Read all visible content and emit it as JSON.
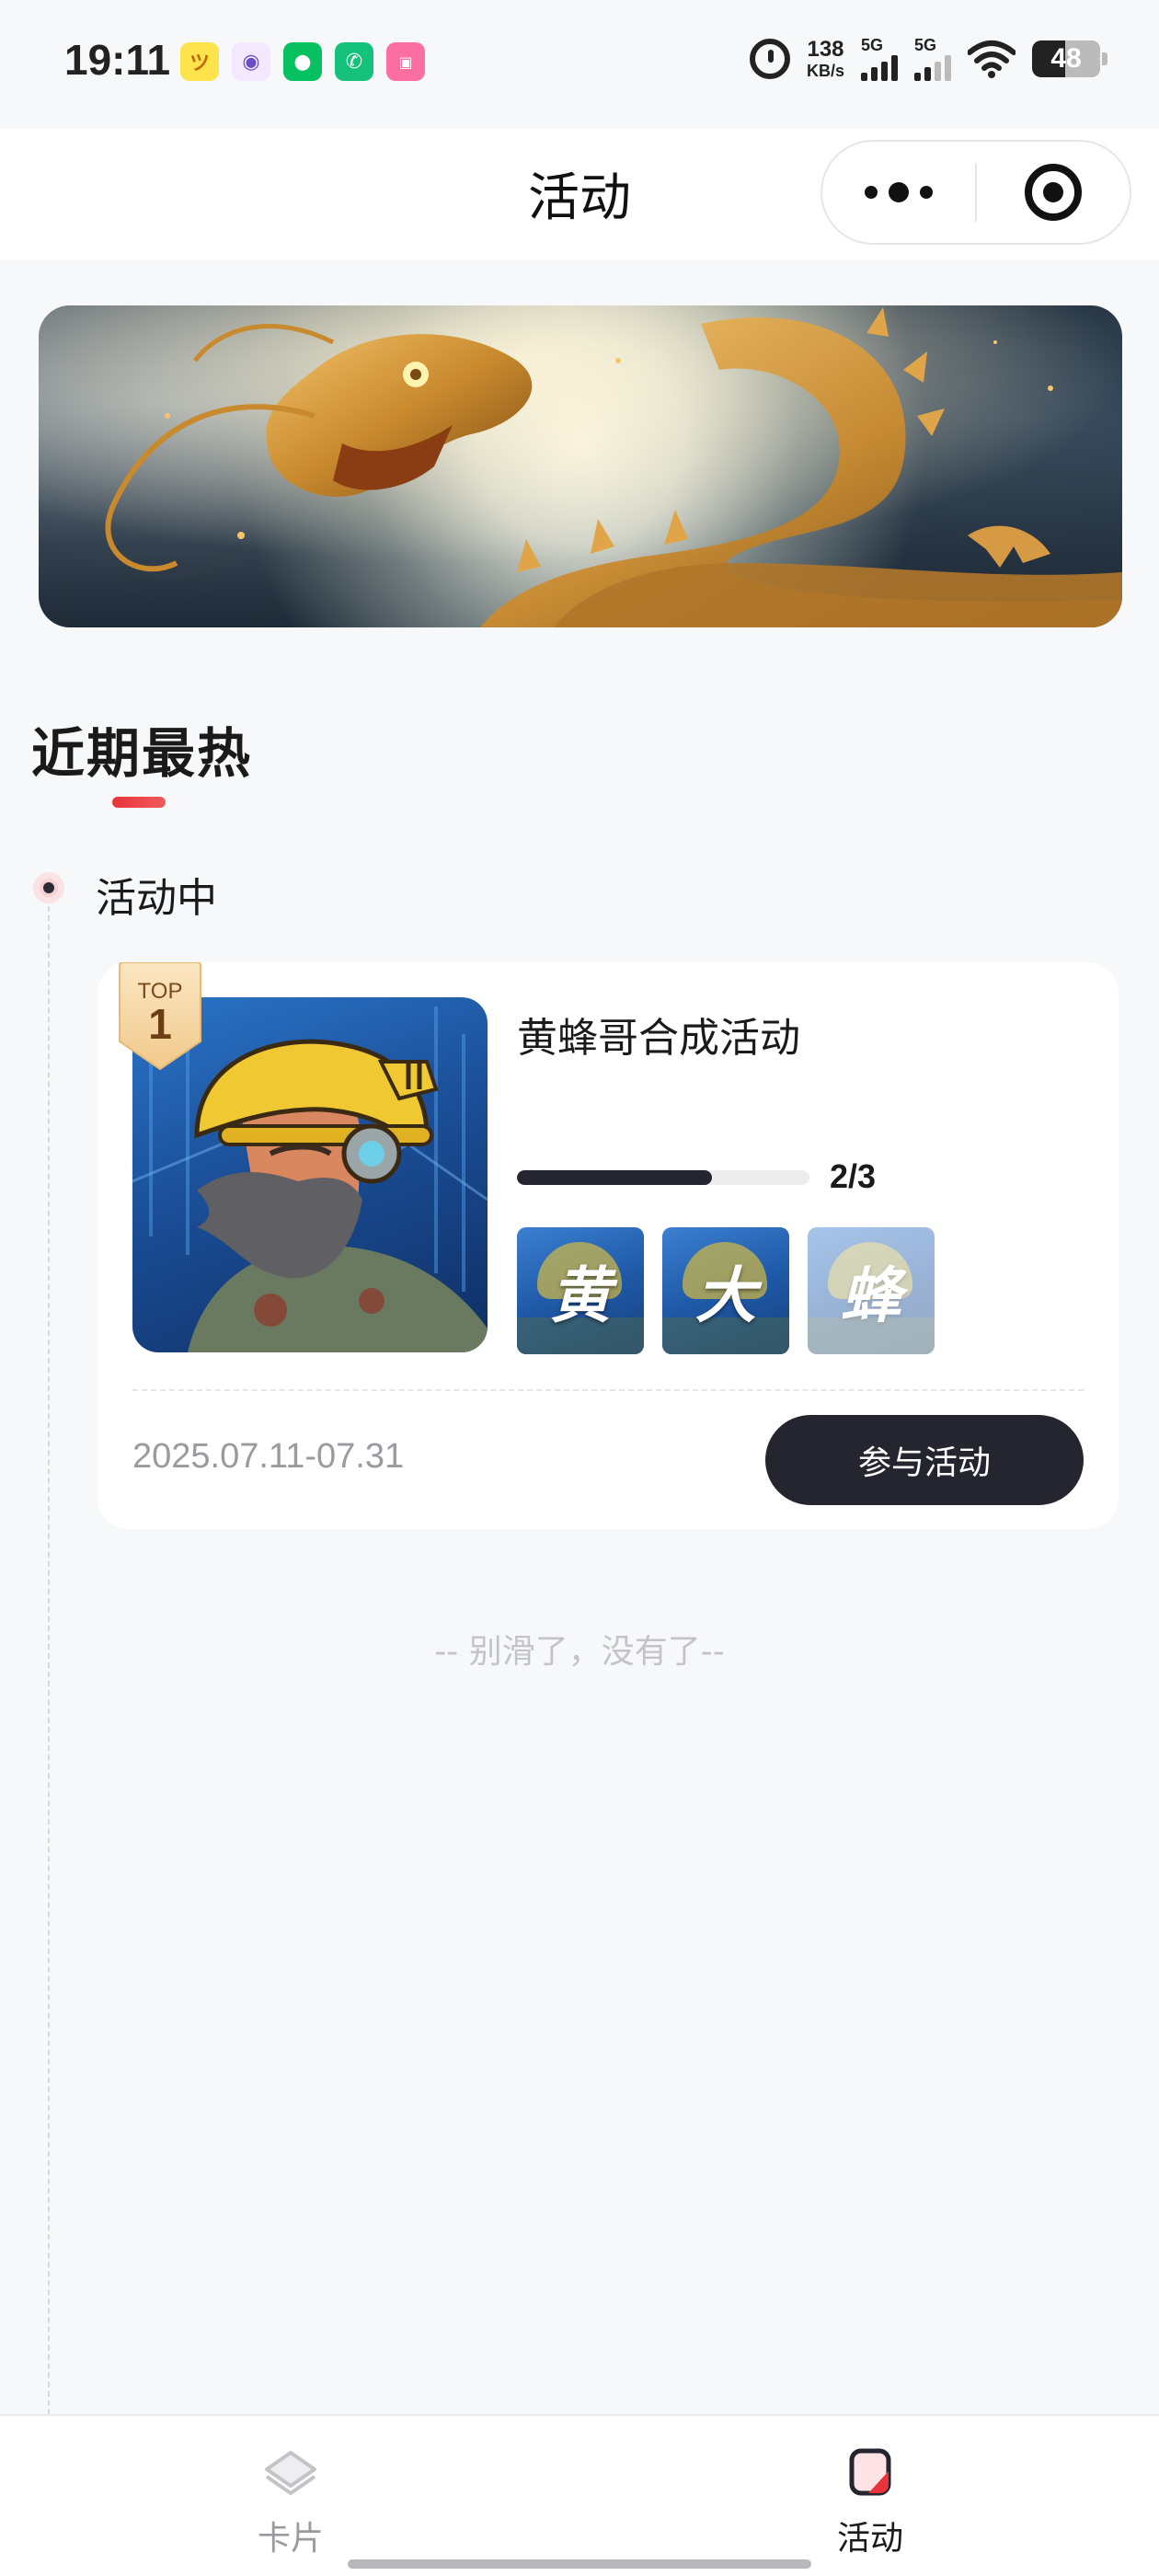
{
  "status_bar": {
    "time": "19:11",
    "net_speed_value": "138",
    "net_speed_unit": "KB/s",
    "sim1_label": "5G",
    "sim2_label": "5G",
    "battery": "48",
    "app_icons": [
      "kid-app-icon",
      "astronaut-app-icon",
      "wechat-icon",
      "phone-app-icon",
      "bilibili-icon"
    ]
  },
  "nav": {
    "title": "活动"
  },
  "section": {
    "title": "近期最热"
  },
  "timeline": {
    "status_label": "活动中"
  },
  "activity": {
    "rank_label": "TOP",
    "rank_number": "1",
    "title": "黄蜂哥合成活动",
    "progress_text": "2/3",
    "progress_fraction": 0.667,
    "characters": [
      {
        "char": "黄",
        "collected": true
      },
      {
        "char": "大",
        "collected": true
      },
      {
        "char": "蜂",
        "collected": false
      }
    ],
    "date_range": "2025.07.11-07.31",
    "join_label": "参与活动"
  },
  "list_end_text": "-- 别滑了，没有了--",
  "tabbar": {
    "items": [
      {
        "label": "卡片",
        "icon": "card-stack-icon",
        "active": false
      },
      {
        "label": "活动",
        "icon": "activity-icon",
        "active": true
      }
    ]
  },
  "colors": {
    "accent_red": "#e8343a",
    "button_dark": "#25252f",
    "background": "#f7f8fa"
  }
}
